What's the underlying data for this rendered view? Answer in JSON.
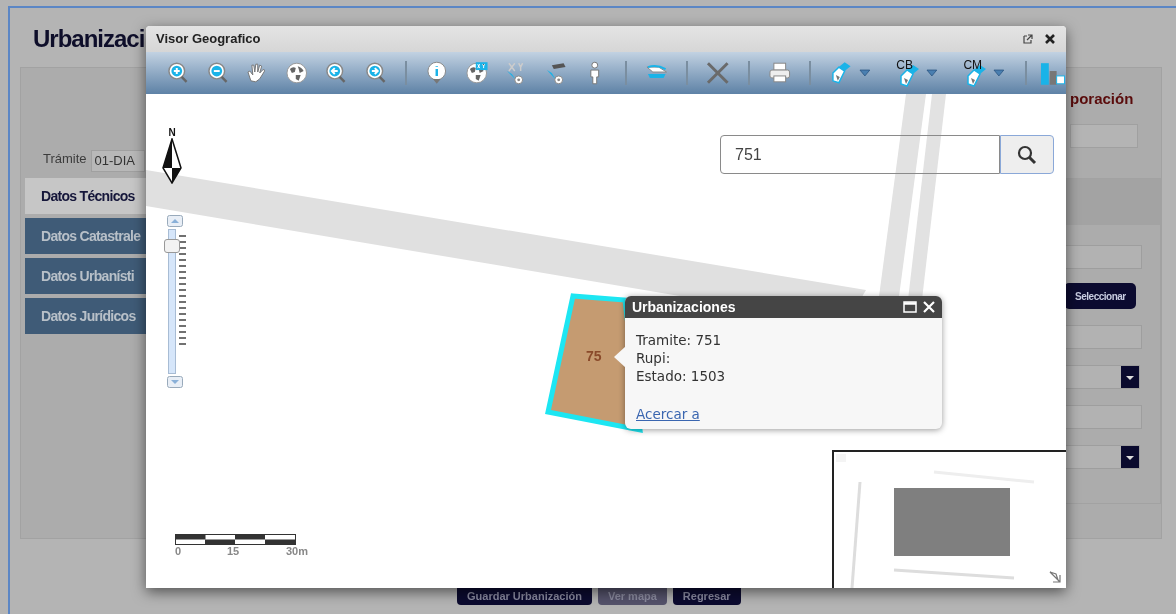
{
  "page": {
    "title": "Urbanizaci",
    "tramite_label": "Trámite",
    "tramite_value": "01-DIA",
    "section_title": "poración",
    "tabs": [
      {
        "label": "Datos Técnicos",
        "selected": true
      },
      {
        "label": "Datos Catastrale",
        "selected": false
      },
      {
        "label": "Datos Urbanísti",
        "selected": false
      },
      {
        "label": "Datos Jurídicos",
        "selected": false
      }
    ],
    "select_button": "Seleccionar",
    "buttons": [
      "Guardar Urbanización",
      "Ver mapa",
      "Regresar"
    ]
  },
  "viewer": {
    "title": "Visor Geografico",
    "tool_labels": [
      "CB",
      "CM"
    ],
    "search": {
      "value": "751"
    },
    "north_label": "N",
    "zoom_slider": {
      "level": 0.93
    },
    "scale_bar": {
      "labels": [
        "0",
        "15",
        "30m"
      ]
    },
    "parcel_label": "75",
    "popup": {
      "title": "Urbanizaciones",
      "lines": [
        "Tramite: 751",
        "Rupi:",
        "Estado: 1503"
      ],
      "link": "Acercar a"
    }
  }
}
